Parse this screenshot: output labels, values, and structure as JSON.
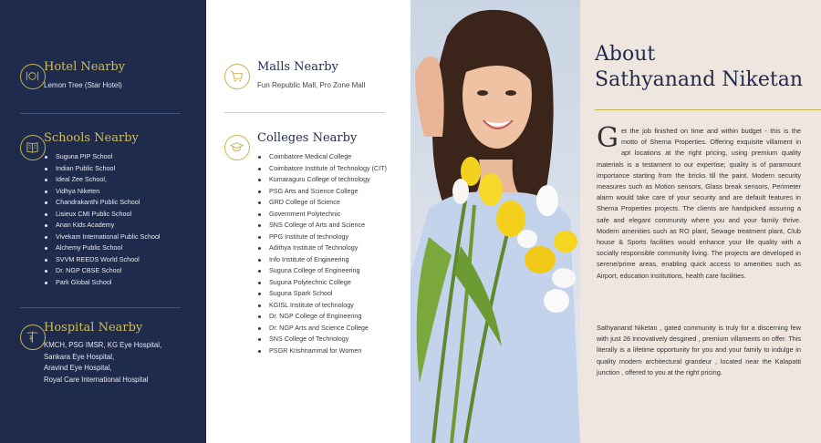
{
  "left": {
    "hotel": {
      "title": "Hotel Nearby",
      "text": "Lemon Tree (Star Hotel)"
    },
    "schools": {
      "title": "Schools Nearby",
      "items": [
        "Suguna PIP School",
        "Indian Public School",
        "Ideal Zee School,",
        "Vidhya Niketen",
        "Chandrakanthi Public School",
        "Lisieux CMI Public School",
        "Anan Kids Academy",
        "Vivekam International Public School",
        "Alchemy Public School",
        "SVVM REEDS World School",
        "Dr. NGP CBSE School",
        "Park Global School"
      ]
    },
    "hospital": {
      "title": "Hospital Nearby",
      "lines": [
        "KMCH, PSG IMSR, KG Eye Hospital,",
        "Sankara Eye Hospital,",
        "Aravind Eye Hospital,",
        "Royal Care International Hospital"
      ]
    }
  },
  "mid": {
    "malls": {
      "title": "Malls Nearby",
      "text": "Fun Republic Mall, Pro Zone Mall"
    },
    "colleges": {
      "title": "Colleges Nearby",
      "items": [
        "Coimbatore Medical College",
        "Coimbatore Institute of Technology (CIT)",
        "Kumaraguru College of technology",
        "PSG Arts and Science College",
        "GRD College of Science",
        "Government Polytechnic",
        "SNS College of Arts and Science",
        "PPG Institute of technology",
        "Adithya Institute of Technology",
        "Info Institute of Engineering",
        "Suguna College of Engineering",
        "Suguna Polytechnic College",
        "Suguna Spark School",
        "KGISL Institute of technology",
        "Dr. NGP College of Engineering",
        "Dr. NGP Arts and Science College",
        "SNS College of Technology",
        "PSGR Krishnammal for Women"
      ]
    }
  },
  "about": {
    "title_line1": "About",
    "title_line2": "Sathyanand Niketan",
    "dropcap": "G",
    "para1": "et the job finished on time and within budget - this is the motto of Sherna Properties. Offering exquisite villament in apt locations at the right pricing, using premium quality materials is a testament to our expertise; quality is of paramount importance starting from the bricks till the paint. Modern security measures such as Motion sensors, Glass break sensors, Perimeter alarm would take care of your security and are default features in Sherna Properties projects. The clients are handpicked assuring a safe and elegant community where you and your family thrive. Modern amenities such as RO plant, Sewage treatment plant, Club house & Sports facilities would enhance your life quality with a socially responsible community living. The projects are developed in serene/prime areas, enabling quick access to amenities such as Airport, education institutions, health care facilities.",
    "para2": "Sathyanand Niketan , gated community is truly for a discerning few with just 26 innovatively desgined , premium villaments on offer. This literally is a lifetime opportunity for you and your family to indulge in quality modern architectural grandeur , located near the Kalapatti junction , offered to you at the right pricing."
  },
  "colors": {
    "navy": "#1f2b4c",
    "gold": "#c7b24a",
    "beige": "#efe6df"
  }
}
